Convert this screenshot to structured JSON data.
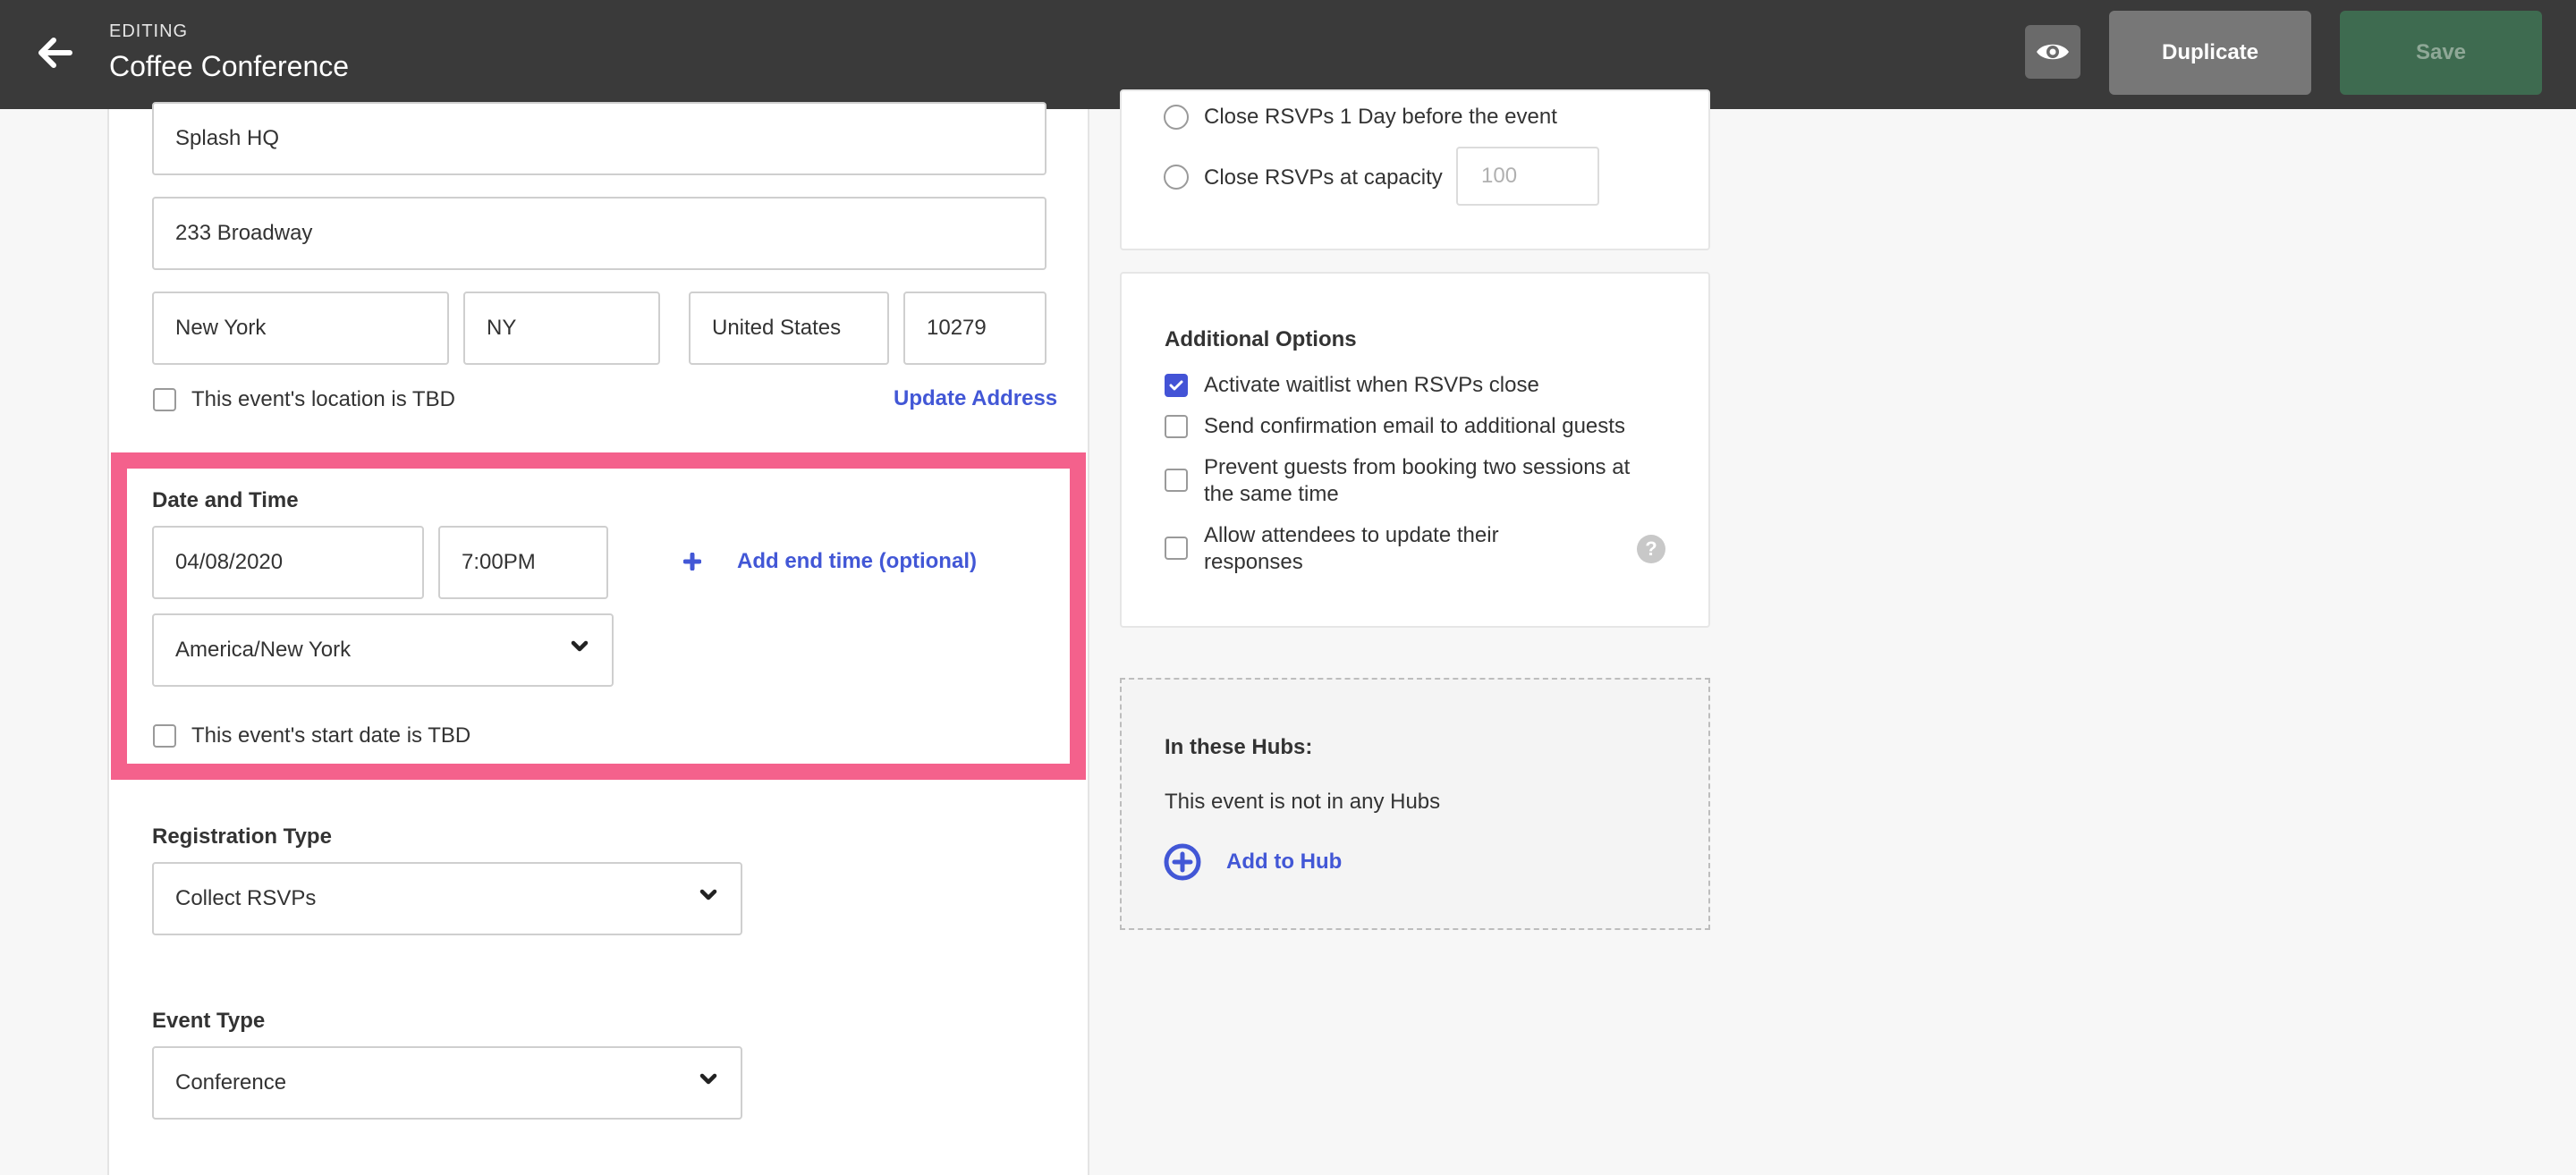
{
  "header": {
    "editing_label": "EDITING",
    "event_title": "Coffee Conference",
    "duplicate_label": "Duplicate",
    "save_label": "Save",
    "icons": {
      "back": "arrow-left-icon",
      "preview": "eye-icon"
    }
  },
  "location": {
    "venue_name": "Splash HQ",
    "street": "233 Broadway",
    "city": "New York",
    "state": "NY",
    "country": "United States",
    "zip": "10279",
    "tbd_label": "This event's location is TBD",
    "update_address_label": "Update Address"
  },
  "datetime": {
    "heading": "Date and Time",
    "date": "04/08/2020",
    "time": "7:00PM",
    "add_end_time_label": "Add end time (optional)",
    "timezone": "America/New York",
    "tbd_label": "This event's start date is TBD"
  },
  "registration": {
    "heading": "Registration Type",
    "value": "Collect RSVPs"
  },
  "event_type": {
    "heading": "Event Type",
    "value": "Conference"
  },
  "rsvp_close": {
    "option_1": "Close RSVPs 1 Day before the event",
    "option_2": "Close RSVPs at capacity",
    "capacity_placeholder": "100"
  },
  "additional_options": {
    "heading": "Additional Options",
    "items": [
      {
        "label": "Activate waitlist when RSVPs close",
        "checked": true
      },
      {
        "label": "Send confirmation email to additional guests",
        "checked": false
      },
      {
        "label_line1": "Prevent guests from booking two sessions at",
        "label_line2": "the same time",
        "checked": false
      },
      {
        "label_line1": "Allow attendees to update their",
        "label_line2": "responses",
        "checked": false
      }
    ],
    "help_icon": "question-circle-icon"
  },
  "hubs": {
    "heading": "In these Hubs:",
    "status": "This event is not in any Hubs",
    "add_label": "Add to Hub",
    "icon": "plus-circle-icon"
  },
  "colors": {
    "header_bg": "#3a3a3a",
    "accent": "#4257d6",
    "highlight": "#f4618c",
    "save_bg": "#3e6b50"
  }
}
